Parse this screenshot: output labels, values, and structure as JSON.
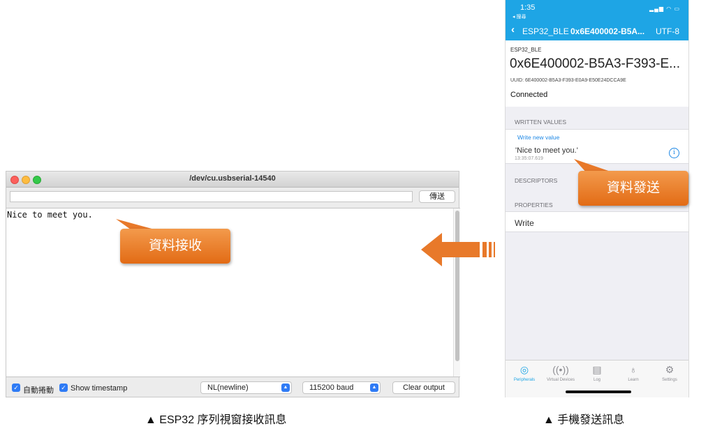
{
  "serial_window": {
    "title": "/dev/cu.usbserial-14540",
    "send_button": "傳送",
    "output_text": "Nice to meet you.",
    "autoscroll_label": "自動捲動",
    "timestamp_label": "Show timestamp",
    "line_ending": "NL(newline)",
    "baud_rate": "115200 baud",
    "clear_button": "Clear output"
  },
  "callouts": {
    "receive": "資料接收",
    "send": "資料發送"
  },
  "phone": {
    "status_time": "1:35",
    "status_back": "◂ 搜尋",
    "nav": {
      "service": "ESP32_BLE",
      "characteristic": "0x6E400002-B5A...",
      "format": "UTF-8"
    },
    "header": {
      "service": "ESP32_BLE",
      "characteristic": "0x6E400002-B5A3-F393-E...",
      "uuid": "UUID: 6E400002-B5A3-F393-E0A9-E50E24DCCA9E",
      "status": "Connected"
    },
    "written_values_header": "WRITTEN VALUES",
    "write_new_value": "Write new value",
    "written_value": "'Nice to meet you.'",
    "written_time": "13:35:07.619",
    "descriptors_header": "DESCRIPTORS",
    "properties_header": "PROPERTIES",
    "property_write": "Write",
    "tabs": [
      {
        "label": "Peripherals",
        "icon": "peripherals-icon"
      },
      {
        "label": "Virtual Devices",
        "icon": "broadcast-icon"
      },
      {
        "label": "Log",
        "icon": "log-icon"
      },
      {
        "label": "Learn",
        "icon": "lightbulb-icon"
      },
      {
        "label": "Settings",
        "icon": "gear-icon"
      }
    ]
  },
  "captions": {
    "left": "▲  ESP32 序列視窗接收訊息",
    "right": "▲  手機發送訊息"
  },
  "colors": {
    "accent": "#1ea5e5",
    "callout": "#e8792a",
    "checkbox": "#2f7bf5"
  }
}
